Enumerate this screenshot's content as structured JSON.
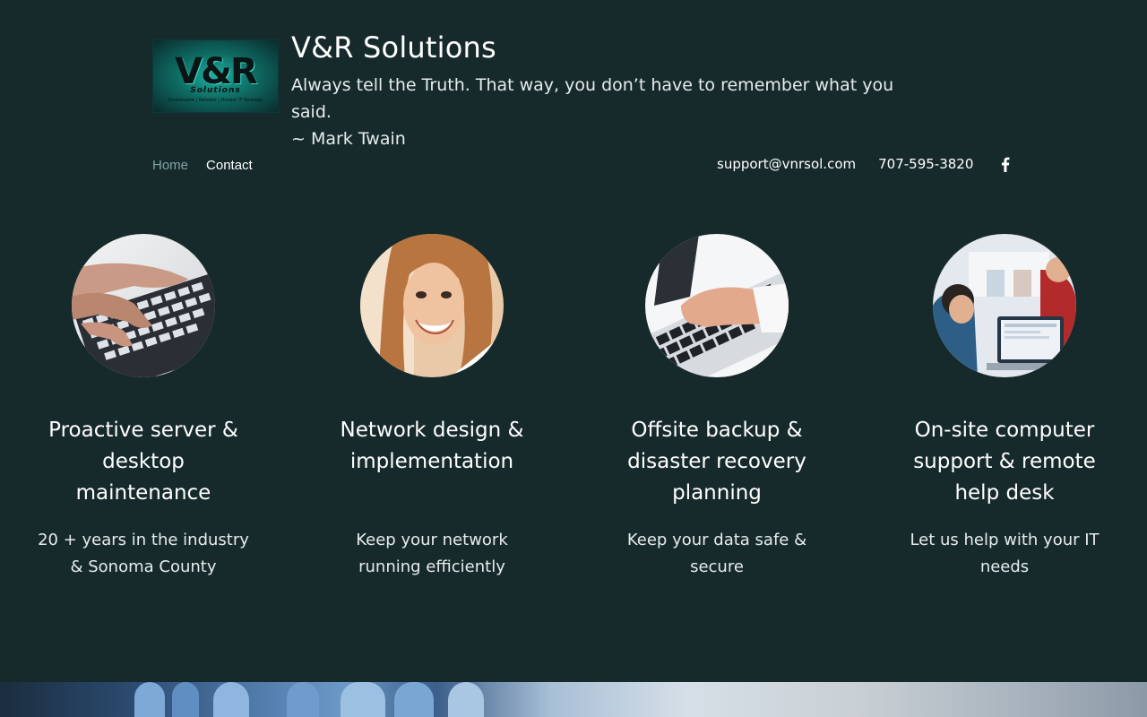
{
  "header": {
    "logo_text": "V&R",
    "logo_sub": "Solutions",
    "logo_tagline": "Sustainable | Reliable | Honest IT Strategy",
    "site_title": "V&R Solutions",
    "quote_line1": "Always tell the Truth. That way, you don’t have to remember what you said.",
    "quote_line2": "~ Mark Twain"
  },
  "nav": {
    "items": [
      {
        "label": "Home",
        "active": true
      },
      {
        "label": "Contact",
        "active": false
      }
    ]
  },
  "contact": {
    "email": "support@vnrsol.com",
    "phone": "707-595-3820",
    "social_icon": "facebook-icon"
  },
  "services": [
    {
      "title": "Proactive server & desktop maintenance",
      "description": "20 + years in the industry & Sonoma County",
      "image": "hands-typing-keyboard-photo"
    },
    {
      "title": "Network design & implementation",
      "description": "Keep your network running efficiently",
      "image": "smiling-woman-headset-photo"
    },
    {
      "title": "Offsite backup & disaster recovery planning",
      "description": "Keep your data safe & secure",
      "image": "hand-on-laptop-keyboard-photo"
    },
    {
      "title": "On-site computer support & remote help desk",
      "description": "Let us help with your IT needs",
      "image": "office-workers-laptop-photo"
    }
  ],
  "colors": {
    "background": "#172a2b",
    "nav_active": "#7fa4a4",
    "text": "#ffffff"
  }
}
